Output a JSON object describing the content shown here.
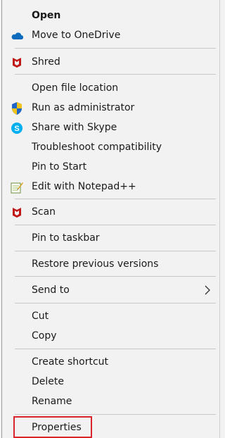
{
  "menu": {
    "items": [
      {
        "id": "open",
        "label": "Open",
        "icon": null,
        "bold": true
      },
      {
        "id": "move-to-onedrive",
        "label": "Move to OneDrive",
        "icon": "onedrive-icon"
      },
      {
        "id": "shred",
        "label": "Shred",
        "icon": "mcafee-icon"
      },
      {
        "id": "open-file-location",
        "label": "Open file location",
        "icon": null
      },
      {
        "id": "run-as-administrator",
        "label": "Run as administrator",
        "icon": "uac-shield-icon"
      },
      {
        "id": "share-with-skype",
        "label": "Share with Skype",
        "icon": "skype-icon"
      },
      {
        "id": "troubleshoot-compatibility",
        "label": "Troubleshoot compatibility",
        "icon": null
      },
      {
        "id": "pin-to-start",
        "label": "Pin to Start",
        "icon": null
      },
      {
        "id": "edit-with-notepadpp",
        "label": "Edit with Notepad++",
        "icon": "notepadpp-icon"
      },
      {
        "id": "scan",
        "label": "Scan",
        "icon": "mcafee-icon"
      },
      {
        "id": "pin-to-taskbar",
        "label": "Pin to taskbar",
        "icon": null
      },
      {
        "id": "restore-previous-versions",
        "label": "Restore previous versions",
        "icon": null
      },
      {
        "id": "send-to",
        "label": "Send to",
        "icon": null,
        "submenu": true
      },
      {
        "id": "cut",
        "label": "Cut",
        "icon": null
      },
      {
        "id": "copy",
        "label": "Copy",
        "icon": null
      },
      {
        "id": "create-shortcut",
        "label": "Create shortcut",
        "icon": null
      },
      {
        "id": "delete",
        "label": "Delete",
        "icon": null
      },
      {
        "id": "rename",
        "label": "Rename",
        "icon": null
      },
      {
        "id": "properties",
        "label": "Properties",
        "icon": null,
        "highlighted": true
      }
    ],
    "highlight_color": "#d9262c",
    "accent_colors": {
      "onedrive": "#0f6cbd",
      "mcafee": "#c01818",
      "skype": "#00aff0",
      "shield_blue": "#1e66c8",
      "shield_yellow": "#f2c318"
    }
  }
}
